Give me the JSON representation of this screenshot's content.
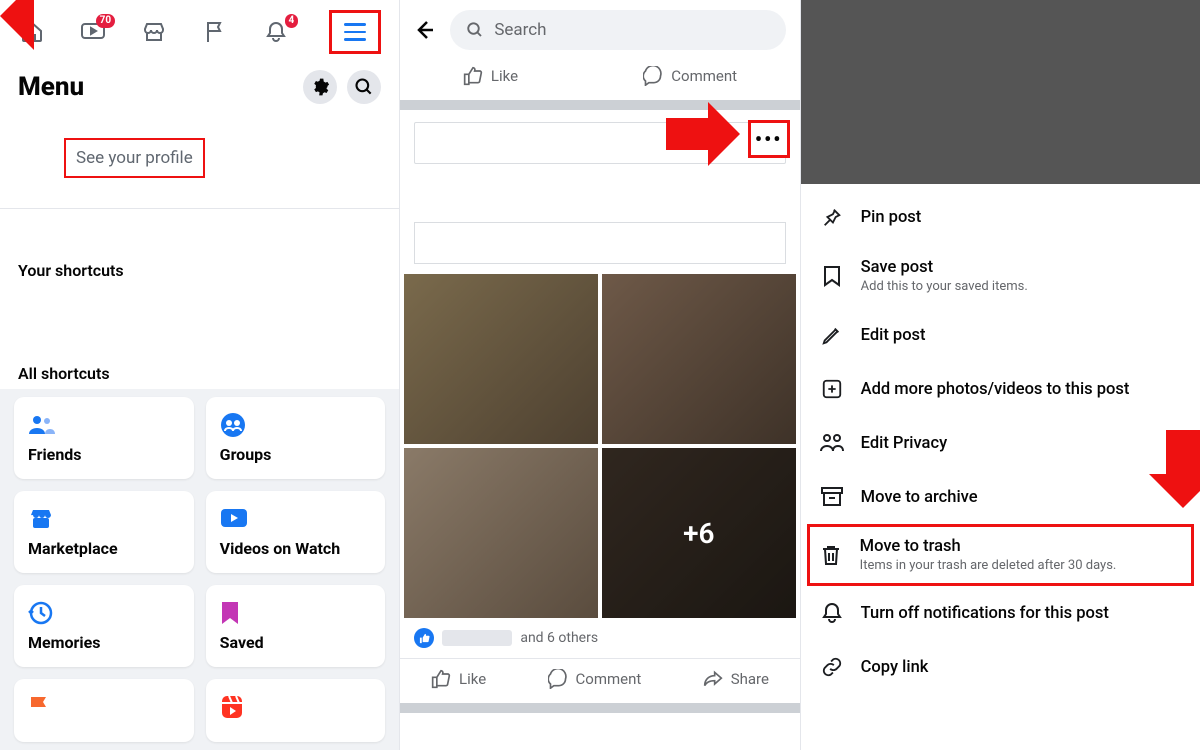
{
  "panel1": {
    "badges": {
      "watch": "70",
      "bell": "4"
    },
    "menu_title": "Menu",
    "see_profile": "See your profile",
    "shortcuts_label": "Your shortcuts",
    "all_label": "All shortcuts",
    "tiles": [
      {
        "label": "Friends"
      },
      {
        "label": "Groups"
      },
      {
        "label": "Marketplace"
      },
      {
        "label": "Videos on Watch"
      },
      {
        "label": "Memories"
      },
      {
        "label": "Saved"
      },
      {
        "label": ""
      },
      {
        "label": ""
      }
    ]
  },
  "panel2": {
    "search_placeholder": "Search",
    "like": "Like",
    "comment": "Comment",
    "share": "Share",
    "more_overlay": "+6",
    "likes_suffix": "and 6 others"
  },
  "panel3": {
    "items": [
      {
        "label": "Pin post",
        "sub": ""
      },
      {
        "label": "Save post",
        "sub": "Add this to your saved items."
      },
      {
        "label": "Edit post",
        "sub": ""
      },
      {
        "label": "Add more photos/videos to this post",
        "sub": ""
      },
      {
        "label": "Edit Privacy",
        "sub": ""
      },
      {
        "label": "Move to archive",
        "sub": ""
      },
      {
        "label": "Move to trash",
        "sub": "Items in your trash are deleted after 30 days."
      },
      {
        "label": "Turn off notifications for this post",
        "sub": ""
      },
      {
        "label": "Copy link",
        "sub": ""
      }
    ]
  }
}
